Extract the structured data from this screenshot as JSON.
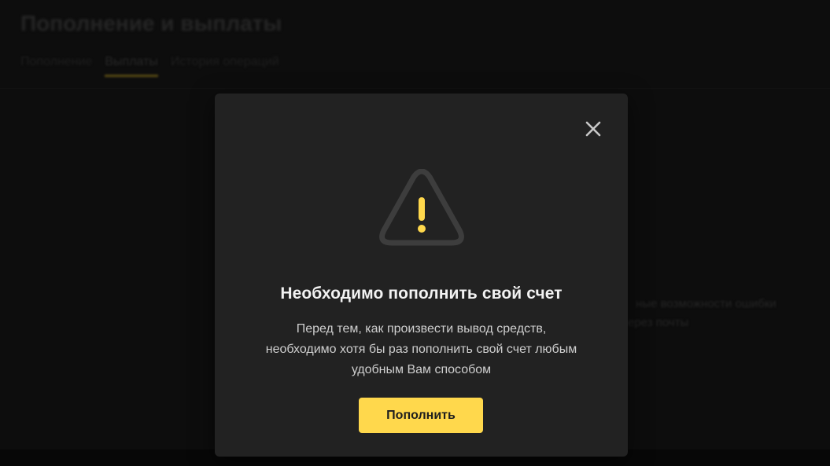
{
  "background": {
    "title": "Пополнение и выплаты",
    "tabs": [
      {
        "label": "Пополнение",
        "active": false
      },
      {
        "label": "Выплаты",
        "active": true
      },
      {
        "label": "История операций",
        "active": false
      }
    ],
    "side_text_1": "ные возможности ошибки",
    "side_text_2": "ерез почты"
  },
  "modal": {
    "icon": "warning-triangle-icon",
    "close_icon": "close-icon",
    "title": "Необходимо пополнить свой счет",
    "text": "Перед тем, как произвести вывод средств,\nнеобходимо хотя бы раз пополнить свой счет любым\nудобным Вам способом",
    "button_label": "Пополнить"
  },
  "colors": {
    "accent": "#ffd84c",
    "modal_bg": "#222222",
    "page_bg": "#141414",
    "icon_outline": "#3d3d3d"
  }
}
